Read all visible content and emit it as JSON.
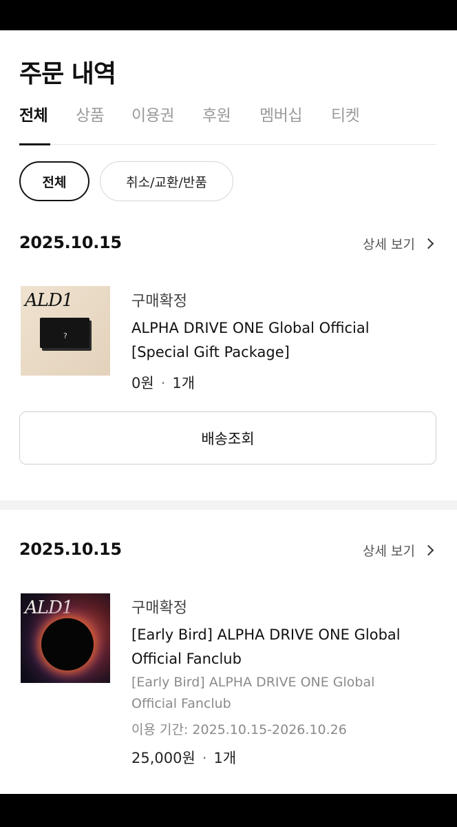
{
  "page": {
    "title": "주문 내역"
  },
  "tabs": [
    {
      "label": "전체",
      "active": true
    },
    {
      "label": "상품",
      "active": false
    },
    {
      "label": "이용권",
      "active": false
    },
    {
      "label": "후원",
      "active": false
    },
    {
      "label": "멤버십",
      "active": false
    },
    {
      "label": "티켓",
      "active": false
    }
  ],
  "filters": [
    {
      "label": "전체",
      "active": true
    },
    {
      "label": "취소/교환/반품",
      "active": false
    }
  ],
  "orders": [
    {
      "date": "2025.10.15",
      "detail_label": "상세 보기",
      "status": "구매확정",
      "name_line1": "ALPHA DRIVE ONE Global Official",
      "name_line2": "[Special Gift Package]",
      "price": "0원",
      "quantity": "1개",
      "thumb_logo": "ALD1",
      "action_label": "배송조회"
    },
    {
      "date": "2025.10.15",
      "detail_label": "상세 보기",
      "status": "구매확정",
      "name_line1": "[Early Bird] ALPHA DRIVE ONE Global",
      "name_line2": "Official Fanclub",
      "sub_line1": "[Early Bird] ALPHA DRIVE ONE Global",
      "sub_line2": "Official Fanclub",
      "period": "이용 기간: 2025.10.15-2026.10.26",
      "price": "25,000원",
      "quantity": "1개",
      "thumb_logo": "ALD1"
    }
  ],
  "icons": {
    "detail_chevron": "chevron-right-icon"
  },
  "colors": {
    "text": "#111111",
    "muted": "#9a9a9a",
    "border": "#d6d6d6"
  }
}
